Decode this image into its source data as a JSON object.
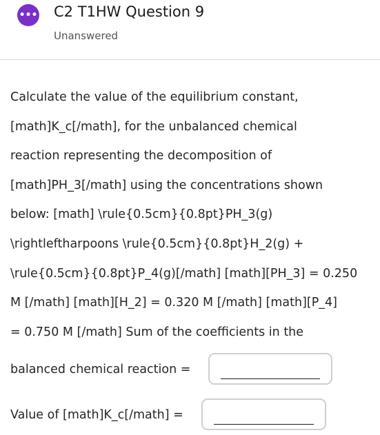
{
  "header": {
    "avatar_glyph": "•••",
    "title": "C2 T1HW Question 9",
    "status": "Unanswered"
  },
  "question": {
    "lines": [
      "Calculate the value of the equilibrium constant,",
      "[math]K_c[/math], for the unbalanced chemical",
      "reaction representing the decomposition of",
      "[math]PH_3[/math] using the concentrations shown",
      "below: [math] \\rule{0.5cm}{0.8pt}PH_3(g)",
      "\\rightleftharpoons \\rule{0.5cm}{0.8pt}H_2(g) +",
      "\\rule{0.5cm}{0.8pt}P_4(g)[/math] [math][PH_3] = 0.250",
      "M [/math] [math][H_2] = 0.320 M [/math] [math][P_4]",
      "= 0.750 M [/math] Sum of the coefficients in the"
    ]
  },
  "answers": [
    {
      "label": "balanced chemical reaction =",
      "value": ""
    },
    {
      "label": "Value of [math]K_c[/math] =",
      "value": ""
    }
  ],
  "colors": {
    "avatar_bg": "#7b2fc9",
    "text": "#262626",
    "divider": "#dcdcdc",
    "box_border": "#cfcfcf"
  }
}
